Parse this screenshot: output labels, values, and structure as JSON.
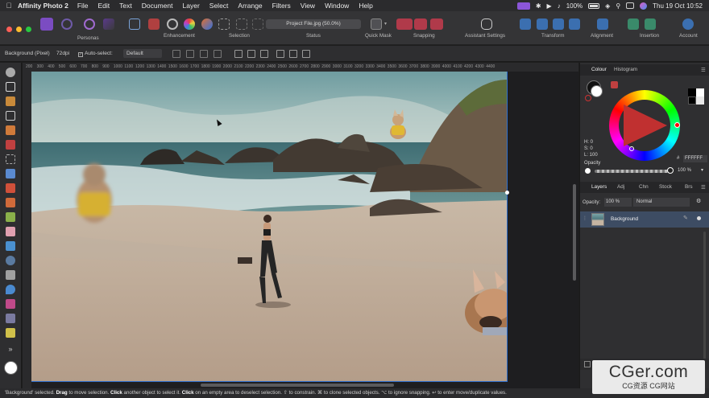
{
  "menubar": {
    "app_name": "Affinity Photo 2",
    "items": [
      "File",
      "Edit",
      "Text",
      "Document",
      "Layer",
      "Select",
      "Arrange",
      "Filters",
      "View",
      "Window",
      "Help"
    ],
    "battery": "100%",
    "datetime": "Thu 19 Oct  10:52"
  },
  "toolbar": {
    "doc_title": "Project File.jpg (50.0%)",
    "labels": {
      "personas": "Personas",
      "enhancement": "Enhancement",
      "selection": "Selection",
      "status": "Status",
      "quick_mask": "Quick Mask",
      "snapping": "Snapping",
      "assistant": "Assistant Settings",
      "transform": "Transform",
      "alignment": "Alignment",
      "insertion": "Insertion",
      "account": "Account"
    }
  },
  "context_bar": {
    "layer_info": "Background (Pixel)",
    "dpi": "72dpi",
    "auto_select_label": "Auto-select:",
    "auto_select_value": "Default"
  },
  "ruler": {
    "ticks": [
      "200",
      "300",
      "400",
      "500",
      "600",
      "700",
      "800",
      "900",
      "1000",
      "1100",
      "1200",
      "1300",
      "1400",
      "1500",
      "1600",
      "1700",
      "1800",
      "1900",
      "2000",
      "2100",
      "2200",
      "2300",
      "2400",
      "2500",
      "2600",
      "2700",
      "2800",
      "2900",
      "3000",
      "3100",
      "3200",
      "3300",
      "3400",
      "3500",
      "3600",
      "3700",
      "3800",
      "3900",
      "4000",
      "4100",
      "4200",
      "4300",
      "4400"
    ]
  },
  "colour_panel": {
    "tabs": [
      "Colour",
      "Histogram"
    ],
    "h": "H: 0",
    "s": "S: 0",
    "l": "L: 100",
    "hex": "FFFFFF",
    "opacity_label": "Opacity",
    "opacity_value": "100 %"
  },
  "layers_panel": {
    "tabs": [
      "Layers",
      "Adj",
      "Chn",
      "Stock",
      "Brs"
    ],
    "opacity_label": "Opacity:",
    "opacity_value": "100 %",
    "blend_mode": "Normal",
    "layers": [
      {
        "name": "Background"
      }
    ]
  },
  "status": {
    "text_parts": [
      {
        "t": "'Background' selected. ",
        "b": false
      },
      {
        "t": "Drag",
        "b": true
      },
      {
        "t": " to move selection. ",
        "b": false
      },
      {
        "t": "Click",
        "b": true
      },
      {
        "t": " another object to select it. ",
        "b": false
      },
      {
        "t": "Click",
        "b": true
      },
      {
        "t": " on an empty area to deselect selection. ",
        "b": false
      },
      {
        "t": "⇧ to constrain. ⌘ to clone selected objects. ⌥ to ignore snapping. ↩ to enter move/duplicate values.",
        "b": false
      }
    ]
  },
  "watermark": {
    "line1": "CGer.com",
    "line2": "CG资源 CG网站"
  },
  "colors": {
    "accent": "#7b4cc2",
    "selection_blue": "#2f6fcc",
    "layer_selected": "#3d4c63"
  }
}
